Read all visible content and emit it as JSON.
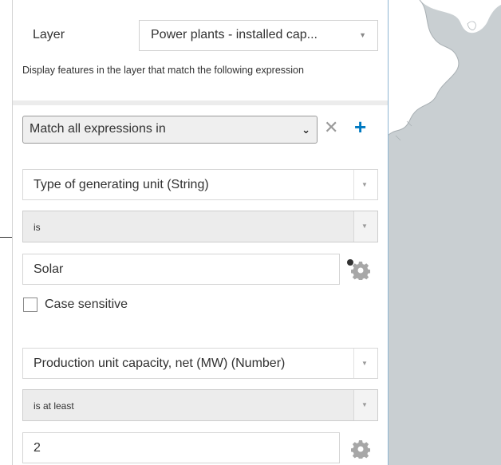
{
  "layer": {
    "label": "Layer",
    "selected": "Power plants - installed cap...",
    "description": "Display features in the layer that match the following expression"
  },
  "match": {
    "selected": "Match all expressions in"
  },
  "expressions": [
    {
      "field": "Type of generating unit (String)",
      "operator": "is",
      "value": "Solar",
      "case_sensitive_label": "Case sensitive",
      "case_sensitive": false
    },
    {
      "field": "Production unit capacity, net (MW) (Number)",
      "operator": "is at least",
      "value": "2"
    }
  ],
  "icons": {
    "remove": "close-icon",
    "add": "plus-icon",
    "settings": "gear-icon",
    "dropdown": "caret-down-icon",
    "select_chevron": "chevron-down-icon"
  },
  "colors": {
    "accent": "#0079c1",
    "map_background": "#c9cfd2"
  }
}
